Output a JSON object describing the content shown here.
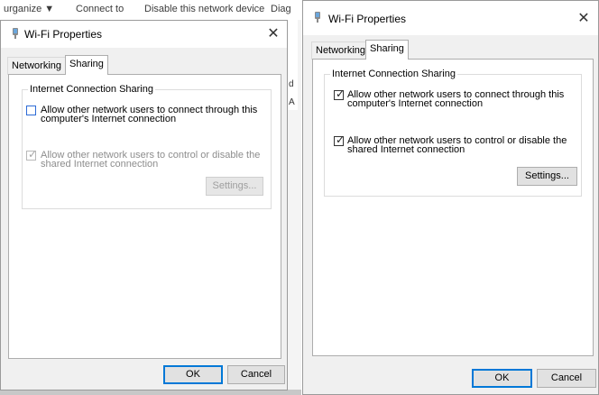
{
  "background": {
    "items": [
      "urganize ▼",
      "Connect to",
      "Disable this network device",
      "Diag"
    ],
    "side_letters": [
      "d",
      "A"
    ]
  },
  "left_dialog": {
    "title": "Wi-Fi Properties",
    "close_symbol": "✕",
    "tabs": [
      {
        "label": "Networking",
        "active": false
      },
      {
        "label": "Sharing",
        "active": true
      }
    ],
    "group_title": "Internet Connection Sharing",
    "option1": {
      "label_line1": "Allow other network users to connect through this",
      "label_line2": "computer's Internet connection",
      "checked": false
    },
    "option2": {
      "label_line1": "Allow other network users to control or disable the",
      "label_line2": "shared Internet connection",
      "checked": true,
      "disabled": true
    },
    "settings_button": "Settings...",
    "ok_button": "OK",
    "cancel_button": "Cancel"
  },
  "right_dialog": {
    "title": "Wi-Fi Properties",
    "close_symbol": "✕",
    "tabs": [
      {
        "label": "Networking",
        "active": false
      },
      {
        "label": "Sharing",
        "active": true
      }
    ],
    "group_title": "Internet Connection Sharing",
    "option1": {
      "label_line1": "Allow other network users to connect through this",
      "label_line2": "computer's Internet connection",
      "checked": true
    },
    "option2": {
      "label_line1": "Allow other network users to control or disable the",
      "label_line2": "shared Internet connection",
      "checked": true
    },
    "settings_button": "Settings...",
    "ok_button": "OK",
    "cancel_button": "Cancel"
  },
  "check_mark": "✓",
  "colors": {
    "focus_blue": "#0078d7",
    "dialog_bg": "#f0f0f0",
    "panel_bg": "#ffffff"
  },
  "icons": {
    "title": "wifi-adapter-icon"
  }
}
